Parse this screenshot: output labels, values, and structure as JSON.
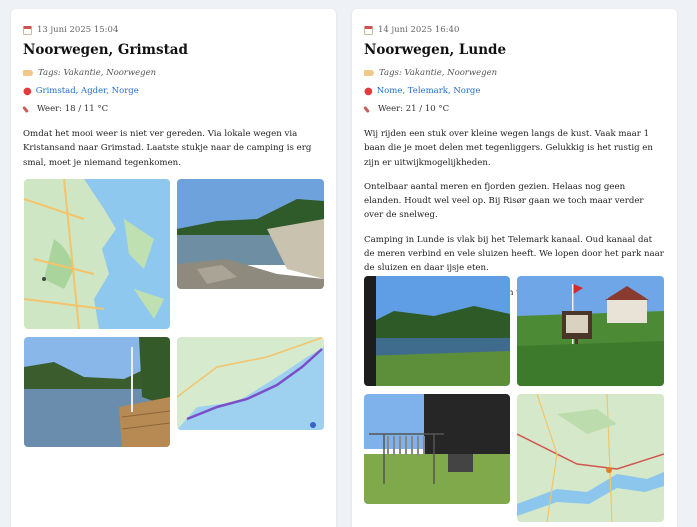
{
  "entries": [
    {
      "datetime": "13 juni 2025 15:04",
      "title": "Noorwegen, Grimstad",
      "tags": "Tags: Vakantie, Noorwegen",
      "location": "Grimstad, Agder, Norge",
      "weather": "Weer: 18 / 11 °C",
      "paragraphs": [
        "Omdat het mooi weer is niet ver gereden. Via lokale wegen via Kristansand naar Grimstad. Laatste stukje naar de camping is erg smal, moet je niemand tegenkomen."
      ],
      "photos": [
        "map-grimstad",
        "lake-rocks",
        "harbor-pier",
        "route-map"
      ]
    },
    {
      "datetime": "14 juni 2025 16:40",
      "title": "Noorwegen, Lunde",
      "tags": "Tags: Vakantie, Noorwegen",
      "location": "Nome, Telemark, Norge",
      "weather": "Weer: 21 / 10 °C",
      "paragraphs": [
        "Wij rijden een stuk over kleine wegen langs de kust. Vaak maar 1 baan die je moet delen met tegenliggers. Gelukkig is het rustig en zijn er uitwijkmogelijkheden.",
        "Ontelbaar aantal meren en fjorden gezien. Helaas nog geen elanden. Houdt wel veel op. Bij Risør gaan we toch maar verder over de snelweg.",
        "Camping in Lunde is vlak bij het Telemark kanaal. Oud kanaal dat de meren verbind en vele sluizen heeft. We lopen door het park naar de sluizen en daar ijsje eten.",
        "Nog mooi weer morgen wat regen verwacht."
      ],
      "photos": [
        "lake-forest",
        "flag-sign",
        "drying-rack",
        "canal-map"
      ]
    }
  ],
  "colors": {
    "link": "#1f6fd0",
    "pin": "#e23b3b",
    "tag": "#f0c98a",
    "calendar": "#cf5252"
  }
}
